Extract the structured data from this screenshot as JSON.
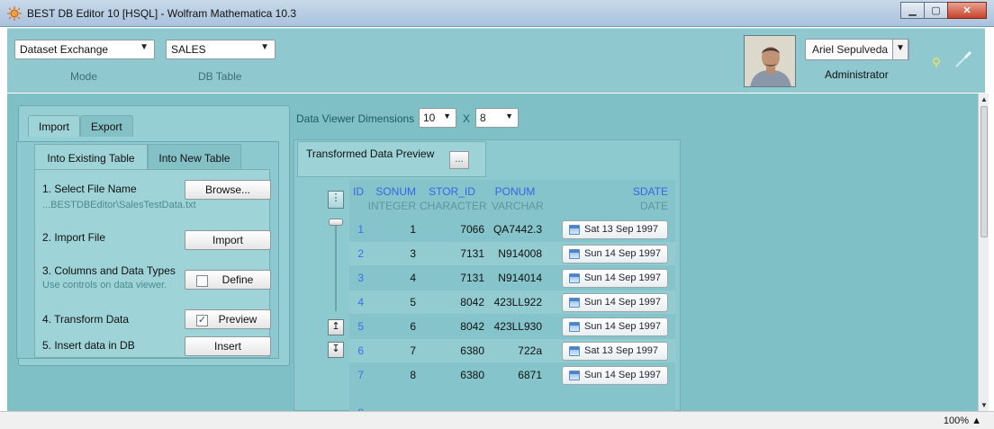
{
  "window": {
    "title": "BEST DB Editor 10 [HSQL] - Wolfram Mathematica 10.3",
    "minimize_glyph": "▁",
    "maximize_glyph": "▢",
    "close_glyph": "✕"
  },
  "header": {
    "mode_value": "Dataset Exchange",
    "mode_caption": "Mode",
    "table_value": "SALES",
    "table_caption": "DB Table",
    "user_name": "Ariel Sepulveda",
    "user_role": "Administrator",
    "icons": [
      "lightbulb-icon",
      "connection-icon"
    ]
  },
  "left_panel": {
    "tabs": [
      "Import",
      "Export"
    ],
    "active_tab": "Import",
    "subtabs": [
      "Into Existing Table",
      "Into New Table"
    ],
    "active_subtab": "Into Existing Table",
    "steps": {
      "select_file": {
        "label": "1.  Select File Name",
        "button": "Browse...",
        "hint": "...BESTDBEditor\\SalesTestData.txt"
      },
      "import_file": {
        "label": "2.  Import File",
        "button": "Import"
      },
      "columns": {
        "label": "3.  Columns and Data Types",
        "hint": "Use controls on data viewer.",
        "button": "Define",
        "checked": false
      },
      "transform": {
        "label": "4.  Transform Data",
        "button": "Preview",
        "checked": true
      },
      "insert": {
        "label": "5.  Insert data in DB",
        "button": "Insert"
      }
    }
  },
  "viewer": {
    "dimensions_label": "Data Viewer Dimensions",
    "rows_value": "10",
    "times_label": "X",
    "cols_value": "8",
    "preview_title": "Transformed Data Preview",
    "preview_button_glyph": "...",
    "menu_glyph": "⋮",
    "scroll_up_glyph": "↥",
    "scroll_down_glyph": "↧",
    "columns": [
      {
        "name": "ID",
        "type": ""
      },
      {
        "name": "SONUM",
        "type": "INTEGER"
      },
      {
        "name": "STOR_ID",
        "type": "CHARACTER"
      },
      {
        "name": "PONUM",
        "type": "VARCHAR"
      },
      {
        "name": "SDATE",
        "type": "DATE"
      }
    ],
    "rows": [
      {
        "id": "1",
        "sonum": "1",
        "stor_id": "7066",
        "ponum": "QA7442.3",
        "sdate": "Sat 13 Sep 1997"
      },
      {
        "id": "2",
        "sonum": "3",
        "stor_id": "7131",
        "ponum": "N914008",
        "sdate": "Sun 14 Sep 1997"
      },
      {
        "id": "3",
        "sonum": "4",
        "stor_id": "7131",
        "ponum": "N914014",
        "sdate": "Sun 14 Sep 1997"
      },
      {
        "id": "4",
        "sonum": "5",
        "stor_id": "8042",
        "ponum": "423LL922",
        "sdate": "Sun 14 Sep 1997"
      },
      {
        "id": "5",
        "sonum": "6",
        "stor_id": "8042",
        "ponum": "423LL930",
        "sdate": "Sun 14 Sep 1997"
      },
      {
        "id": "6",
        "sonum": "7",
        "stor_id": "6380",
        "ponum": "722a",
        "sdate": "Sat 13 Sep 1997"
      },
      {
        "id": "7",
        "sonum": "8",
        "stor_id": "6380",
        "ponum": "6871",
        "sdate": "Sun 14 Sep 1997"
      }
    ]
  },
  "status": {
    "zoom": "100%",
    "zoom_arrow": "▲"
  }
}
